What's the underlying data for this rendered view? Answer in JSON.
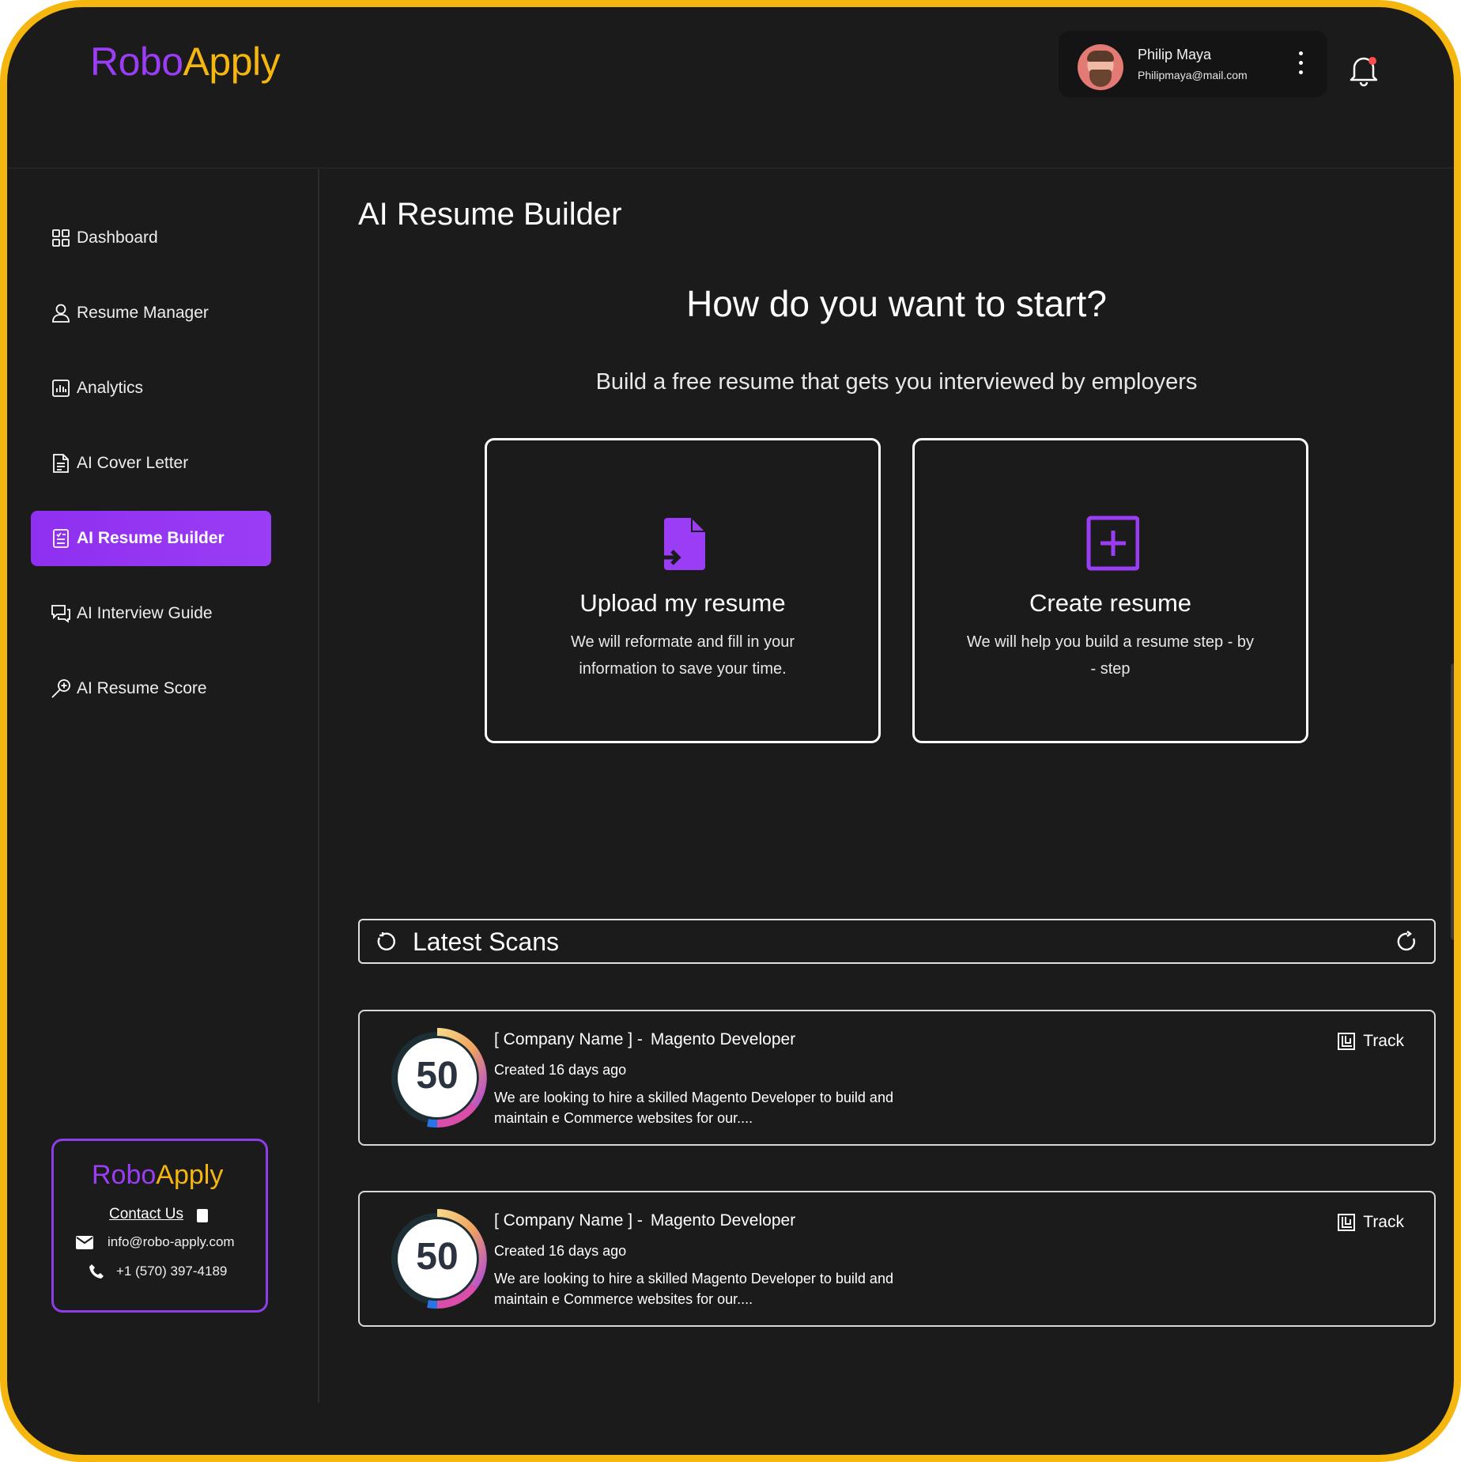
{
  "brand": {
    "part1": "Robo",
    "part2": "Apply",
    "color_purple": "#9b3df5",
    "color_yellow": "#f5b60f"
  },
  "user": {
    "name": "Philip Maya",
    "email": "Philipmaya@mail.com"
  },
  "sidebar": {
    "items": [
      {
        "label": "Dashboard",
        "icon": "dashboard-icon"
      },
      {
        "label": "Resume Manager",
        "icon": "user-icon"
      },
      {
        "label": "Analytics",
        "icon": "analytics-icon"
      },
      {
        "label": "AI Cover Letter",
        "icon": "document-icon"
      },
      {
        "label": "AI Resume Builder",
        "icon": "resume-icon",
        "active": true
      },
      {
        "label": "AI Interview Guide",
        "icon": "chat-icon"
      },
      {
        "label": "AI Resume Score",
        "icon": "magnifier-plus-icon"
      }
    ],
    "contact": {
      "logo_part1": "Robo",
      "logo_part2": "Apply",
      "contact_us": "Contact Us",
      "email": "info@robo-apply.com",
      "phone": "+1 (570) 397-4189"
    }
  },
  "main": {
    "page_title": "AI Resume Builder",
    "question": "How do you want to start?",
    "subtitle": "Build a free resume that gets you interviewed by employers",
    "options": [
      {
        "title": "Upload my resume",
        "desc": "We will reformate and fill in your information to save your time.",
        "icon": "upload-file-icon"
      },
      {
        "title": "Create resume",
        "desc": "We will help you build a resume step - by - step",
        "icon": "plus-square-icon"
      }
    ],
    "scans_title": "Latest Scans",
    "scans": [
      {
        "score": "50",
        "score_value": 50,
        "company": "[ Company Name ] -",
        "role": "Magento Developer",
        "created": "Created 16 days ago",
        "desc": "We are looking to hire a skilled Magento Developer to build and maintain e Commerce websites for our....",
        "action": "Track"
      },
      {
        "score": "50",
        "score_value": 50,
        "company": "[ Company Name ] -",
        "role": "Magento Developer",
        "created": "Created 16 days ago",
        "desc": "We are looking to hire a skilled Magento Developer to build and maintain e Commerce websites for our....",
        "action": "Track"
      }
    ]
  }
}
